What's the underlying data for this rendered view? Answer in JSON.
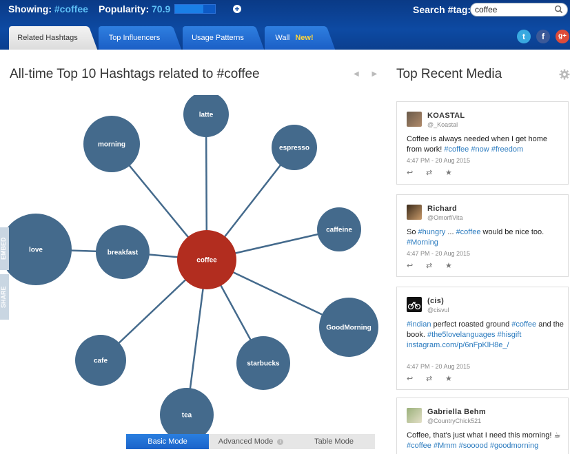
{
  "header": {
    "showing_label": "Showing:",
    "showing_tag": "#coffee",
    "popularity_label": "Popularity:",
    "popularity_value": "70.9",
    "popularity_fraction": 0.709,
    "search_label": "Search #tag:",
    "search_value": "coffee"
  },
  "tabs": [
    {
      "label": "Related Hashtags",
      "active": true
    },
    {
      "label": "Top Influencers",
      "active": false
    },
    {
      "label": "Usage Patterns",
      "active": false
    },
    {
      "label": "Wall",
      "badge": "New!",
      "active": false
    }
  ],
  "social": {
    "twitter": "t",
    "facebook": "f",
    "google": "g+"
  },
  "left": {
    "title": "All-time Top 10 Hashtags related to #coffee",
    "arrows": "◀ ▶",
    "side_tabs": [
      "EMBED",
      "SHARE"
    ],
    "graph": {
      "center": "coffee",
      "nodes": [
        "latte",
        "morning",
        "espresso",
        "caffeine",
        "love",
        "breakfast",
        "GoodMorning",
        "cafe",
        "starbucks",
        "tea"
      ],
      "colors": {
        "center": "#b22d1f",
        "node": "#446a8c",
        "link": "#446a8c"
      }
    },
    "modes": [
      {
        "label": "Basic Mode",
        "active": true
      },
      {
        "label": "Advanced Mode",
        "info": "i",
        "active": false
      },
      {
        "label": "Table Mode",
        "active": false
      }
    ]
  },
  "right": {
    "title": "Top Recent Media",
    "posts": [
      {
        "name": "KOASTAL",
        "handle": "@_Koastal",
        "text_parts": [
          "Coffee is always needed when I get home from work! ",
          "#coffee",
          " ",
          "#now",
          " ",
          "#freedom"
        ],
        "time": "4:47 PM - 20 Aug 2015"
      },
      {
        "name": "Richard",
        "handle": "@OmorfiVita",
        "text_parts": [
          "So ",
          "#hungry",
          " ... ",
          "#coffee",
          " would be nice too. ",
          "#Morning"
        ],
        "time": "4:47 PM - 20 Aug 2015"
      },
      {
        "name": "(cis)",
        "handle": "@cisvul",
        "text_parts": [
          "#indian",
          " perfect roasted ground ",
          "#coffee",
          " and the book. ",
          "#the5lovelanguages",
          " ",
          "#hisgift",
          " ",
          "instagram.com/p/6nFpKlH8e_/"
        ],
        "time": "4:47 PM - 20 Aug 2015"
      },
      {
        "name": "Gabriella Behm",
        "handle": "@CountryChick521",
        "text_parts": [
          "Coffee, that's just what I need this morning! ☕ ",
          "#coffee",
          " ",
          "#Mmm",
          " ",
          "#sooood",
          " ",
          "#goodmorning"
        ],
        "time": ""
      }
    ],
    "action_icons": [
      "reply-icon",
      "retweet-icon",
      "favorite-icon"
    ]
  }
}
